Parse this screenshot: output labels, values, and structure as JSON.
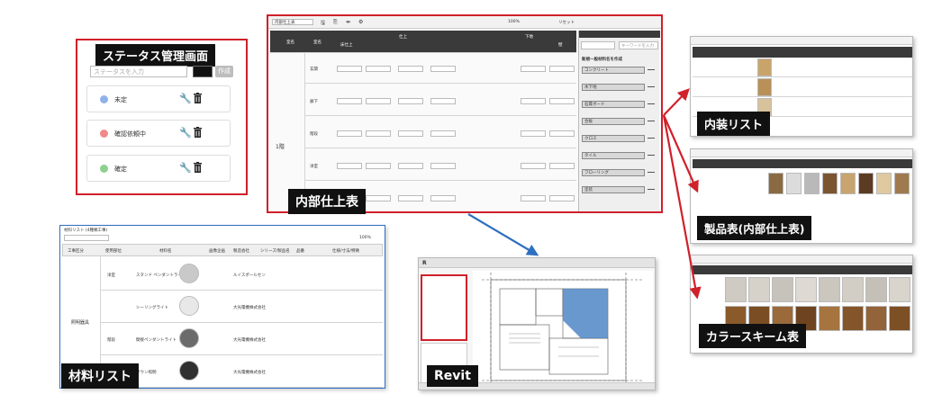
{
  "status_panel": {
    "title": "ステータス管理画面",
    "input_placeholder": "ステータスを入力",
    "create_button": "作成",
    "statuses": [
      {
        "label": "未定",
        "color": "#8fb3e8"
      },
      {
        "label": "確認依頼中",
        "color": "#f08a8a"
      },
      {
        "label": "確定",
        "color": "#8ed08e"
      }
    ]
  },
  "interior_finish": {
    "label": "内部仕上表",
    "toolbar": {
      "view_select": "内部仕上表",
      "zoom": "100%",
      "reset": "リセット"
    },
    "headers": {
      "room": "室名",
      "floor_style": "床仕上",
      "finish_group": "仕上",
      "floor_material": "下地",
      "wall": "壁",
      "skirting": "巾木",
      "ceiling": "天井"
    },
    "floor_label": "1階",
    "rooms": [
      "玄関",
      "廊下",
      "階段",
      "洋室",
      "洗面所"
    ],
    "sidebar": {
      "search_placeholder": "キーワードを入力",
      "section": "新規一般材料名を作成",
      "items": [
        "コンクリート",
        "木下地",
        "石膏ボード",
        "合板",
        "クロス",
        "タイル",
        "フローリング",
        "塗装"
      ]
    }
  },
  "material_list": {
    "label": "材料リスト",
    "title": "材料リスト (4種類工事)",
    "zoom": "100%",
    "headers": [
      "工事区分",
      "使用部位",
      "材料名",
      "画像企画",
      "製造会社",
      "シリーズ/製品名",
      "品番",
      "仕様/寸法/特徴"
    ],
    "category": "照明器具",
    "rows": [
      {
        "part": "洋室",
        "name": "スタンド ペンダントライト",
        "maker": "ルイスポールセン"
      },
      {
        "part": "",
        "name": "シーリングライト",
        "maker": "大光電機株式会社"
      },
      {
        "part": "階段",
        "name": "間接ペンダントライト",
        "maker": "大光電機株式会社"
      },
      {
        "part": "",
        "name": "ダウン照明",
        "maker": "大光電機株式会社"
      }
    ]
  },
  "revit": {
    "label": "Revit"
  },
  "naiso_list": {
    "label": "内装リスト"
  },
  "product_table": {
    "label": "製品表(内部仕上表)"
  },
  "color_scheme": {
    "label": "カラースキーム表"
  },
  "colors": {
    "accent_red": "#d0202a",
    "accent_blue": "#2f6fc0",
    "dark": "#111111"
  }
}
